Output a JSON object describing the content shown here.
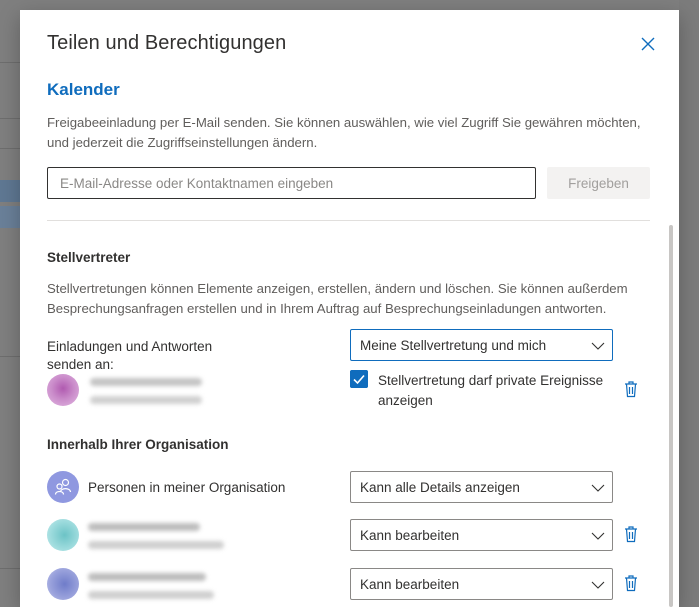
{
  "dialog": {
    "title": "Teilen und Berechtigungen",
    "section_title": "Kalender",
    "intro": "Freigabeeinladung per E-Mail senden. Sie können auswählen, wie viel Zugriff Sie gewähren möchten, und jederzeit die Zugriffseinstellungen ändern.",
    "email_placeholder": "E-Mail-Adresse oder Kontaktnamen eingeben",
    "share_button": "Freigeben"
  },
  "delegate": {
    "heading": "Stellvertreter",
    "description": "Stellvertretungen können Elemente anzeigen, erstellen, ändern und löschen. Sie können außerdem Besprechungsanfragen erstellen und in Ihrem Auftrag auf Besprechungseinladungen antworten.",
    "send_to_label": "Einladungen und Antworten senden an:",
    "send_to_value": "Meine Stellvertretung und mich",
    "private_events_label": "Stellvertretung darf private Ereignisse anzeigen",
    "private_events_checked": true
  },
  "organization": {
    "heading": "Innerhalb Ihrer Organisation",
    "people_label": "Personen in meiner Organisation",
    "people_permission": "Kann alle Details anzeigen",
    "members": [
      {
        "permission": "Kann bearbeiten",
        "avatar_color": "#8fd6d8"
      },
      {
        "permission": "Kann bearbeiten",
        "avatar_color": "#8d96d6"
      }
    ]
  },
  "colors": {
    "accent": "#0f6cbd",
    "delegate_avatar": "#c97fc9",
    "org_avatar": "#8f98e0"
  },
  "icons": {
    "close": "close-icon",
    "chevron": "chevron-down-icon",
    "trash": "trash-icon",
    "checkbox": "checkmark-icon",
    "people": "people-icon"
  }
}
